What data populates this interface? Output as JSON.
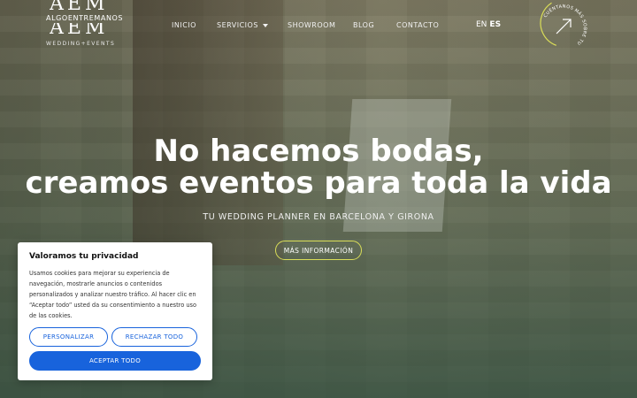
{
  "brand": {
    "logo_mark": "AEM",
    "name": "ALGOENTREMANOS",
    "tagline": "WEDDING+EVENTS"
  },
  "nav": {
    "items": [
      {
        "label": "INICIO"
      },
      {
        "label": "SERVICIOS"
      },
      {
        "label": "SHOWROOM"
      },
      {
        "label": "BLOG"
      },
      {
        "label": "CONTACTO"
      }
    ],
    "languages": [
      "EN",
      "ES"
    ],
    "active_language": "ES"
  },
  "badge": {
    "text": "CUÉNTANOS MÁS SOBRE TU BODA",
    "icon": "arrow-up-right-icon",
    "accent_color": "#d9dd58"
  },
  "hero": {
    "title_line1": "No hacemos bodas,",
    "title_line2": "creamos eventos para toda la vida",
    "subtitle": "TU WEDDING PLANNER EN BARCELONA Y GIRONA",
    "cta_label": "MÁS INFORMACIÓN",
    "cta_border_color": "#d9dd58"
  },
  "cookie_banner": {
    "title": "Valoramos tu privacidad",
    "body": "Usamos cookies para mejorar su experiencia de navegación, mostrarle anuncios o contenidos personalizados y analizar nuestro tráfico. Al hacer clic en “Aceptar todo” usted da su consentimiento a nuestro uso de las cookies.",
    "customize_label": "PERSONALIZAR",
    "reject_label": "RECHAZAR TODO",
    "accept_label": "ACEPTAR TODO",
    "button_color": "#1863dc"
  }
}
